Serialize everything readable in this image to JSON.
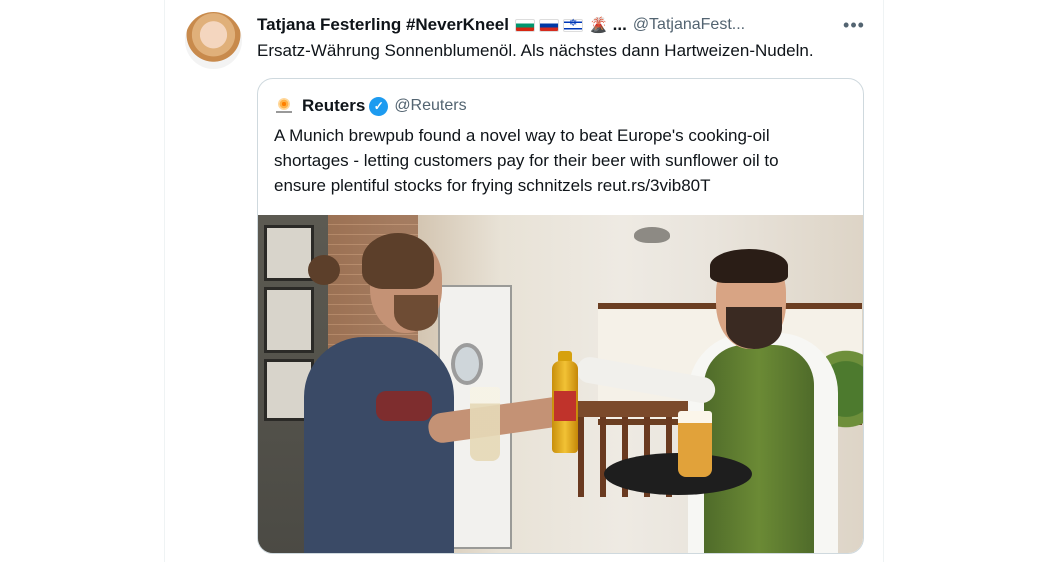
{
  "tweet": {
    "author_name": "Tatjana Festerling #NeverKneel",
    "author_name_suffix": "...",
    "handle": "@TatjanaFest...",
    "more_label": "•••",
    "text": "Ersatz-Währung Sonnenblumenöl. Als nächstes dann Hartweizen-Nudeln.",
    "flag_icons": [
      "flag-bulgaria-icon",
      "flag-russia-icon",
      "flag-israel-icon",
      "volcano-icon"
    ]
  },
  "quoted_tweet": {
    "author_name": "Reuters",
    "verified": true,
    "handle": "@Reuters",
    "text": "A Munich brewpub found a novel way to beat Europe's cooking-oil shortages - letting customers pay for their beer with sunflower oil to ensure plentiful stocks for frying schnitzels reut.rs/3vib80T"
  },
  "colors": {
    "text": "#0f1419",
    "secondary": "#536471",
    "verified_blue": "#1d9bf0",
    "border": "#cfd9de"
  }
}
